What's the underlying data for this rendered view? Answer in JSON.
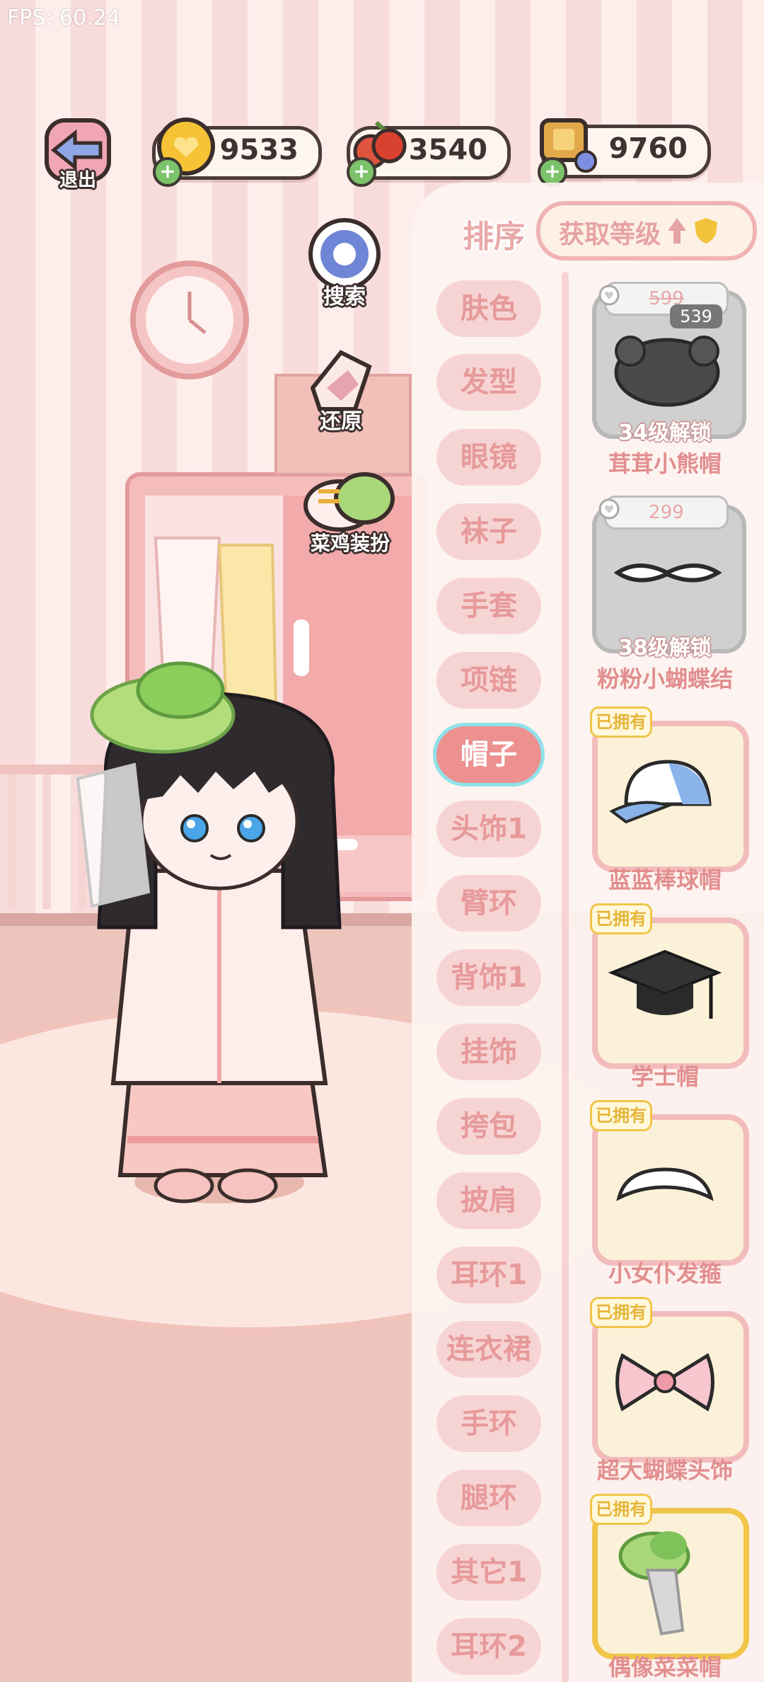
{
  "fps_label": "FPS: 60.24",
  "top_bar": {
    "exit_label": "退出",
    "coins": "9533",
    "cherries": "3540",
    "tickets": "9760"
  },
  "side_buttons": {
    "search_label": "搜索",
    "restore_label": "还原",
    "outfit_label": "菜鸡装扮"
  },
  "panel": {
    "sort_label": "排序",
    "sort_button_label": "获取等级",
    "categories": [
      "肤色",
      "发型",
      "眼镜",
      "袜子",
      "手套",
      "项链",
      "帽子",
      "头饰1",
      "臂环",
      "背饰1",
      "挂饰",
      "挎包",
      "披肩",
      "耳环1",
      "连衣裙",
      "手环",
      "腿环",
      "其它1",
      "耳环2"
    ],
    "selected_category": "帽子",
    "items": [
      {
        "name": "茸茸小熊帽",
        "status": "34级解锁",
        "price_original": "599",
        "price": "539"
      },
      {
        "name": "粉粉小蝴蝶结",
        "status": "38级解锁",
        "price": "299"
      },
      {
        "name": "蓝蓝棒球帽",
        "tag": "已拥有"
      },
      {
        "name": "学士帽",
        "tag": "已拥有"
      },
      {
        "name": "小女仆发箍",
        "tag": "已拥有"
      },
      {
        "name": "超大蝴蝶头饰",
        "tag": "已拥有"
      },
      {
        "name": "偶像菜菜帽",
        "tag": "已拥有"
      }
    ]
  },
  "colors": {
    "accent_pink": "#ec9090",
    "panel_bg": "#fdf4f1",
    "selected_outline": "#8fe2e8",
    "owned_gold": "#f0c548"
  }
}
